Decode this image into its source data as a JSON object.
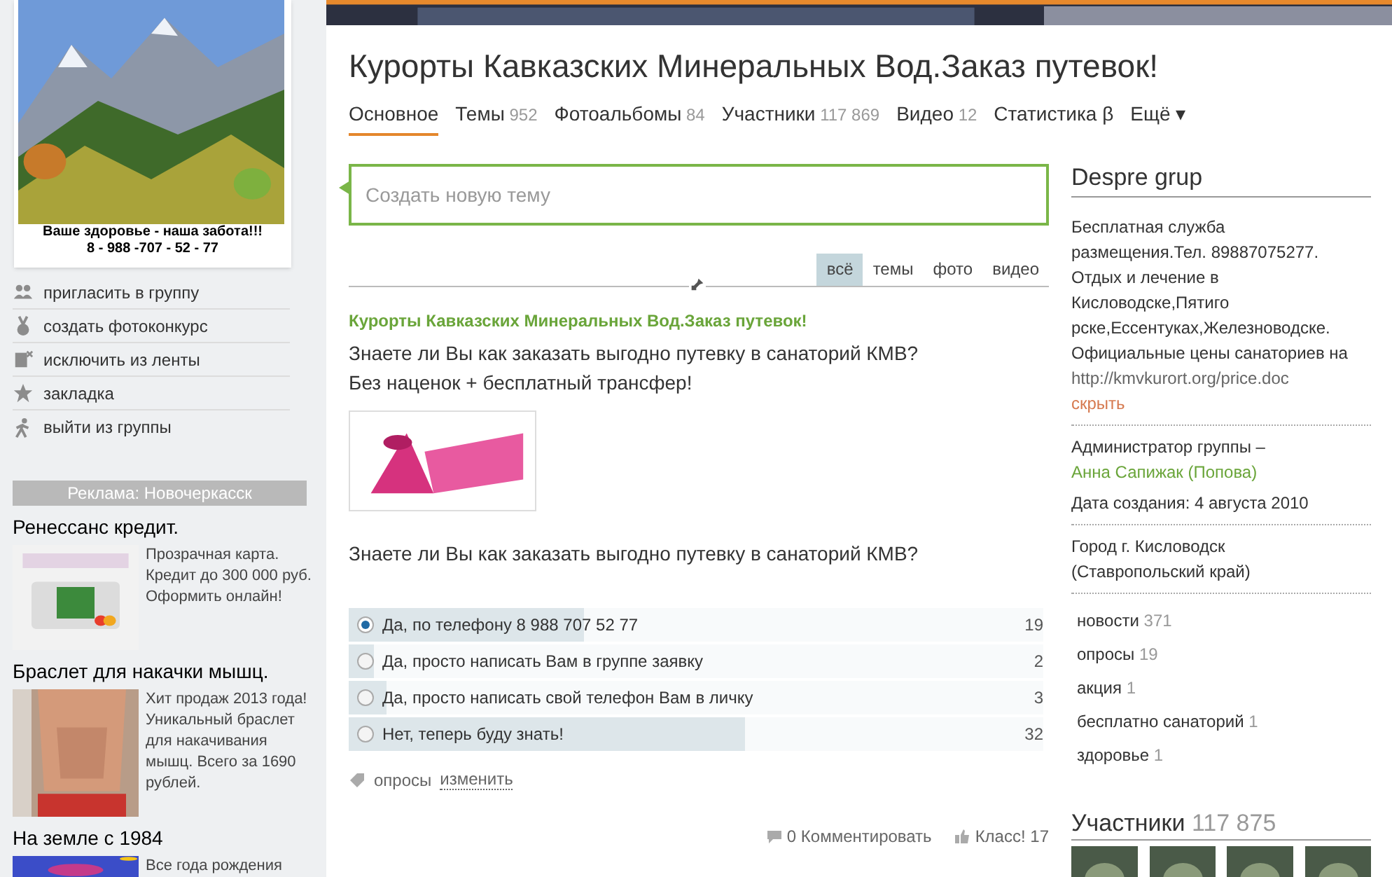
{
  "group_photo": {
    "caption": "Ваше здоровье - наша забота!!!",
    "phone": "8 - 988 -707 - 52 - 77"
  },
  "actions": [
    {
      "label": "пригласить в группу"
    },
    {
      "label": "создать фотоконкурс"
    },
    {
      "label": "исключить из ленты"
    },
    {
      "label": "закладка"
    },
    {
      "label": "выйти из группы"
    }
  ],
  "ads": {
    "header": "Реклама: Новочеркасск",
    "items": [
      {
        "title": "Ренессанс кредит.",
        "text": "Прозрачная карта. Кредит до 300 000 руб. Оформить онлайн!",
        "kind": "card"
      },
      {
        "title": "Браслет для накачки мышц.",
        "text": "Хит продаж 2013 года! Уникальный браслет для накачивания мышц. Всего за 1690 рублей.",
        "kind": "figure"
      },
      {
        "title": "На земле с 1984",
        "text": "Все года рождения",
        "kind": "cut"
      }
    ]
  },
  "title": "Курорты Кавказских Минеральных Вод.Заказ путевок!",
  "tabs": [
    {
      "label": "Основное",
      "selected": true
    },
    {
      "label": "Темы",
      "count": "952",
      "selected": false
    },
    {
      "label": "Фотоальбомы",
      "count": "84",
      "selected": false
    },
    {
      "label": "Участники",
      "count": "117 869",
      "selected": false
    },
    {
      "label": "Видео",
      "count": "12",
      "selected": false
    },
    {
      "label": "Статистика β",
      "selected": false
    },
    {
      "label": "Ещё ▾",
      "selected": false
    }
  ],
  "new_topic": {
    "placeholder": "Создать новую тему"
  },
  "filters": [
    {
      "label": "всё",
      "selected": true
    },
    {
      "label": "темы",
      "selected": false
    },
    {
      "label": "фото",
      "selected": false
    },
    {
      "label": "видео",
      "selected": false
    }
  ],
  "post": {
    "group": "Курорты Кавказских Минеральных Вод.Заказ путевок!",
    "lines": [
      "Знаете ли Вы как заказать выгодно путевку в санаторий КМВ?",
      "Без наценок + бесплатный трансфер!"
    ],
    "question": "Знаете ли Вы как заказать выгодно путевку в санаторий КМВ?",
    "options": [
      {
        "label": "Да, по телефону 8 988 707 52 77",
        "votes": "19",
        "level": 0.339,
        "selected": true
      },
      {
        "label": "Да, просто написать Вам в группе заявку",
        "votes": "2",
        "level": 0.036,
        "selected": false
      },
      {
        "label": "Да, просто написать свой телефон Вам в личку",
        "votes": "3",
        "level": 0.054,
        "selected": false
      },
      {
        "label": "Нет, теперь буду знать!",
        "votes": "32",
        "level": 0.571,
        "selected": false
      }
    ],
    "tag": "опросы",
    "edit": "изменить",
    "comments": "0 Комментировать",
    "likes": "Класс! 17"
  },
  "about": {
    "heading": "Despre grup",
    "description": [
      "Бесплатная служба",
      "размещения.Тел. 89887075277.",
      "Отдых и лечение в",
      "Кисловодске,Пятиго",
      "рске,Ессентуках,Железноводске.",
      "Официальные цены санаториев на",
      "http://kmvkurort.org/price.doc"
    ],
    "hide": "скрыть",
    "admin_label": "Администратор группы –",
    "admin": "Анна Сапижак (Попова)",
    "created": "Дата создания: 4 августа 2010",
    "city": [
      "Город г. Кисловодск",
      "(Ставропольский край)"
    ]
  },
  "topics": [
    {
      "label": "новости",
      "count": "371"
    },
    {
      "label": "опросы",
      "count": "19"
    },
    {
      "label": "акция",
      "count": "1"
    },
    {
      "label": "бесплатно санаторий",
      "count": "1"
    },
    {
      "label": "здоровье",
      "count": "1"
    }
  ],
  "members": {
    "label": "Участники",
    "count": "117 875"
  }
}
